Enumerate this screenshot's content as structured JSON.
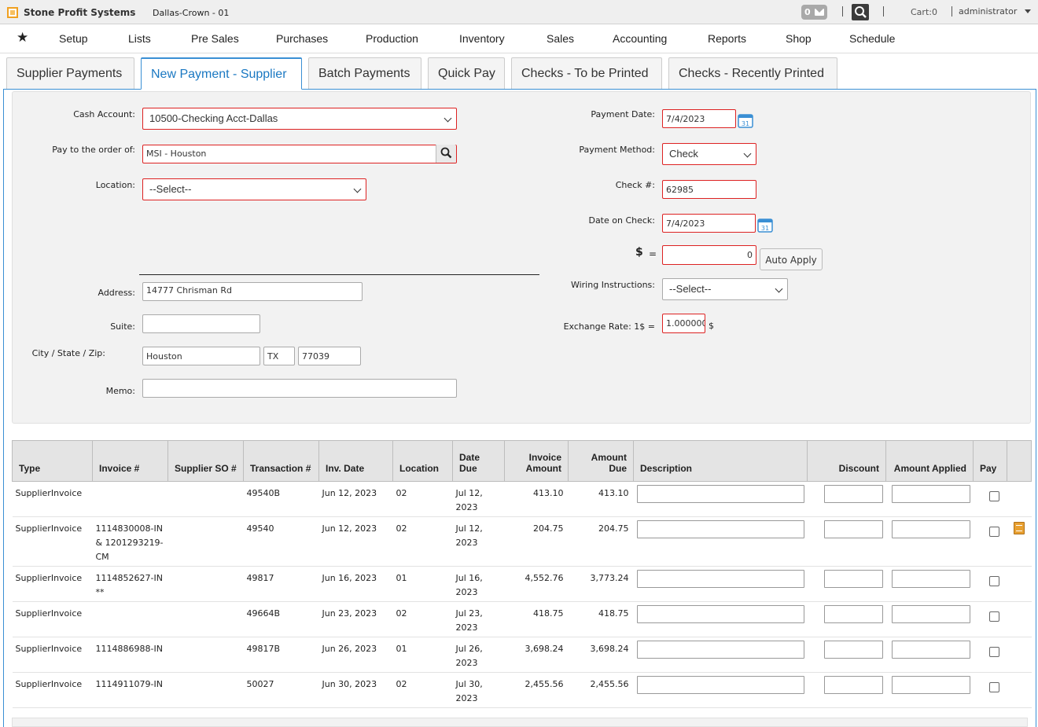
{
  "app": {
    "title": "Stone Profit Systems",
    "company": "Dallas-Crown - 01",
    "message_count": "0",
    "cart": "Cart:0",
    "user": "administrator"
  },
  "nav": {
    "items": [
      "Setup",
      "Lists",
      "Pre Sales",
      "Purchases",
      "Production",
      "Inventory",
      "Sales",
      "Accounting",
      "Reports",
      "Shop",
      "Schedule"
    ]
  },
  "tabs": [
    "Supplier Payments",
    "New Payment - Supplier",
    "Batch Payments",
    "Quick Pay",
    "Checks - To be Printed",
    "Checks - Recently Printed"
  ],
  "active_tab": "New Payment - Supplier",
  "form": {
    "cash_account_label": "Cash Account:",
    "cash_account_value": "10500-Checking Acct-Dallas",
    "pay_to_label": "Pay to the order of:",
    "pay_to_value": "MSI - Houston",
    "location_label": "Location:",
    "location_value": "--Select--",
    "address_label": "Address:",
    "address_value": "14777 Chrisman Rd",
    "suite_label": "Suite:",
    "suite_value": "",
    "city_label": "City / State / Zip:",
    "city_value": "Houston",
    "state_value": "TX",
    "zip_value": "77039",
    "memo_label": "Memo:",
    "memo_value": "",
    "payment_date_label": "Payment Date:",
    "payment_date_value": "7/4/2023",
    "payment_method_label": "Payment Method:",
    "payment_method_value": "Check",
    "check_no_label": "Check #:",
    "check_no_value": "62985",
    "date_on_check_label": "Date on Check:",
    "date_on_check_value": "7/4/2023",
    "amount_label": "$",
    "amount_eq": "=",
    "amount_value": "0",
    "auto_apply_label": "Auto Apply",
    "wiring_label": "Wiring Instructions:",
    "wiring_value": "--Select--",
    "exchange_label": "Exchange Rate: 1$ =",
    "exchange_value": "1.000000",
    "exchange_unit": "$",
    "calendar_day": "31"
  },
  "table": {
    "headers": {
      "type": "Type",
      "invoice": "Invoice #",
      "supplier_so": "Supplier SO #",
      "transaction": "Transaction #",
      "inv_date": "Inv. Date",
      "location": "Location",
      "date_due_1": "Date",
      "date_due_2": "Due",
      "invoice_amount_1": "Invoice",
      "invoice_amount_2": "Amount",
      "amount_due_1": "Amount",
      "amount_due_2": "Due",
      "description": "Description",
      "discount": "Discount",
      "amount_applied": "Amount Applied",
      "pay": "Pay"
    },
    "rows": [
      {
        "type": "SupplierInvoice",
        "invoice": "",
        "supplier_so": "",
        "transaction": "49540B",
        "inv_date": "Jun 12, 2023",
        "location": "02",
        "date_due": "Jul 12, 2023",
        "invoice_amount": "413.10",
        "amount_due": "413.10",
        "note": false
      },
      {
        "type": "SupplierInvoice",
        "invoice": "1114830008-IN & 1201293219-CM",
        "supplier_so": "",
        "transaction": "49540",
        "inv_date": "Jun 12, 2023",
        "location": "02",
        "date_due": "Jul 12, 2023",
        "invoice_amount": "204.75",
        "amount_due": "204.75",
        "note": true
      },
      {
        "type": "SupplierInvoice",
        "invoice": "1114852627-IN **",
        "supplier_so": "",
        "transaction": "49817",
        "inv_date": "Jun 16, 2023",
        "location": "01",
        "date_due": "Jul 16, 2023",
        "invoice_amount": "4,552.76",
        "amount_due": "3,773.24",
        "note": false
      },
      {
        "type": "SupplierInvoice",
        "invoice": "",
        "supplier_so": "",
        "transaction": "49664B",
        "inv_date": "Jun 23, 2023",
        "location": "02",
        "date_due": "Jul 23, 2023",
        "invoice_amount": "418.75",
        "amount_due": "418.75",
        "note": false
      },
      {
        "type": "SupplierInvoice",
        "invoice": "1114886988-IN",
        "supplier_so": "",
        "transaction": "49817B",
        "inv_date": "Jun 26, 2023",
        "location": "01",
        "date_due": "Jul 26, 2023",
        "invoice_amount": "3,698.24",
        "amount_due": "3,698.24",
        "note": false
      },
      {
        "type": "SupplierInvoice",
        "invoice": "1114911079-IN",
        "supplier_so": "",
        "transaction": "50027",
        "inv_date": "Jun 30, 2023",
        "location": "02",
        "date_due": "Jul 30, 2023",
        "invoice_amount": "2,455.56",
        "amount_due": "2,455.56",
        "note": false
      }
    ]
  }
}
